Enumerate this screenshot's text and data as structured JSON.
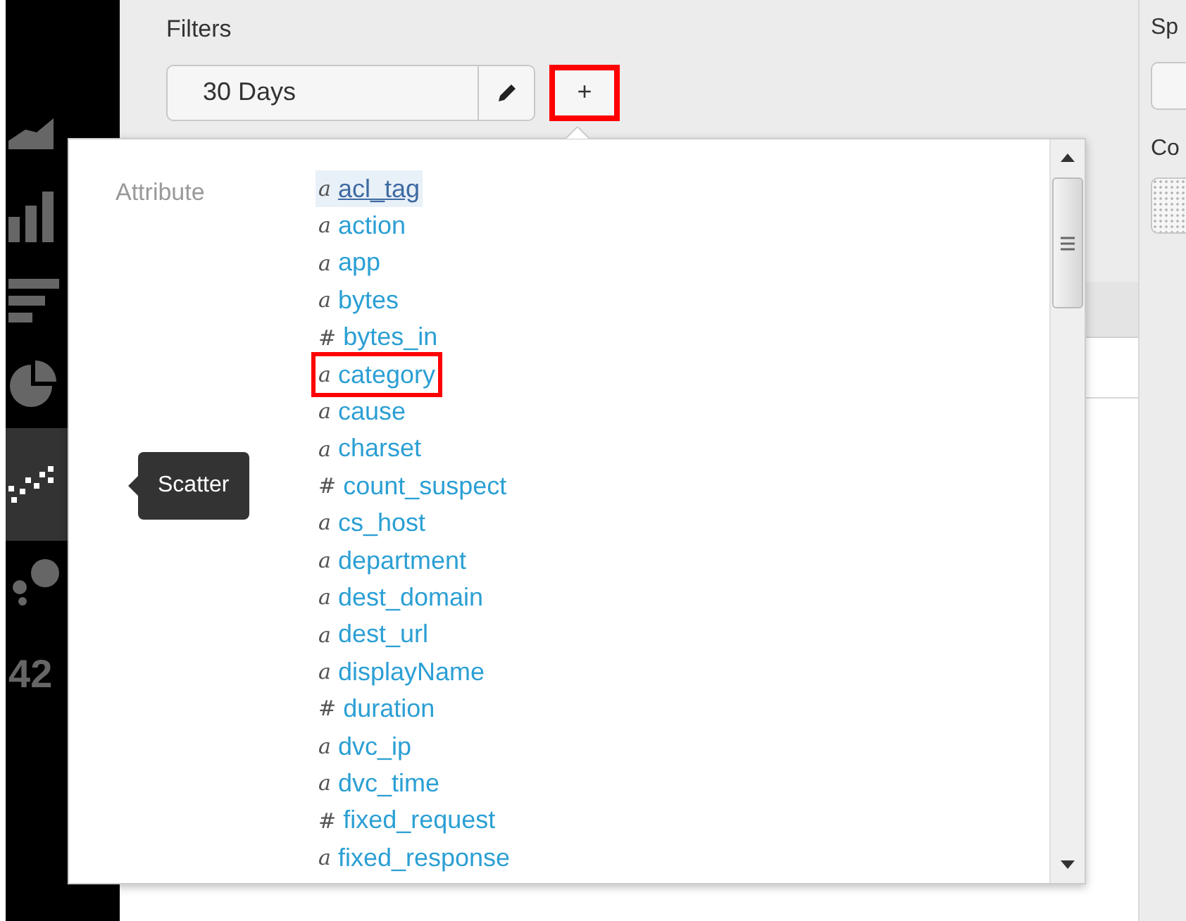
{
  "sidebar": {
    "items": [
      {
        "kind": "area",
        "selected": false
      },
      {
        "kind": "column",
        "selected": false
      },
      {
        "kind": "bar",
        "selected": false
      },
      {
        "kind": "pie",
        "selected": false
      },
      {
        "kind": "scatter",
        "selected": true
      },
      {
        "kind": "bubble",
        "selected": false
      },
      {
        "kind": "single",
        "label": "42",
        "selected": false
      }
    ],
    "tooltip": "Scatter"
  },
  "filters": {
    "label": "Filters",
    "value": "30 Days",
    "add_button": "+",
    "add_highlighted": true
  },
  "right_panel": {
    "label_1": "Sp",
    "label_2": "Co"
  },
  "popup": {
    "heading": "Attribute",
    "items": [
      {
        "glyph": "a",
        "name": "acl_tag",
        "selected": true,
        "highlighted": false
      },
      {
        "glyph": "a",
        "name": "action",
        "selected": false,
        "highlighted": false
      },
      {
        "glyph": "a",
        "name": "app",
        "selected": false,
        "highlighted": false
      },
      {
        "glyph": "a",
        "name": "bytes",
        "selected": false,
        "highlighted": false
      },
      {
        "glyph": "#",
        "name": "bytes_in",
        "selected": false,
        "highlighted": false
      },
      {
        "glyph": "a",
        "name": "category",
        "selected": false,
        "highlighted": true
      },
      {
        "glyph": "a",
        "name": "cause",
        "selected": false,
        "highlighted": false
      },
      {
        "glyph": "a",
        "name": "charset",
        "selected": false,
        "highlighted": false
      },
      {
        "glyph": "#",
        "name": "count_suspect",
        "selected": false,
        "highlighted": false
      },
      {
        "glyph": "a",
        "name": "cs_host",
        "selected": false,
        "highlighted": false
      },
      {
        "glyph": "a",
        "name": "department",
        "selected": false,
        "highlighted": false
      },
      {
        "glyph": "a",
        "name": "dest_domain",
        "selected": false,
        "highlighted": false
      },
      {
        "glyph": "a",
        "name": "dest_url",
        "selected": false,
        "highlighted": false
      },
      {
        "glyph": "a",
        "name": "displayName",
        "selected": false,
        "highlighted": false
      },
      {
        "glyph": "#",
        "name": "duration",
        "selected": false,
        "highlighted": false
      },
      {
        "glyph": "a",
        "name": "dvc_ip",
        "selected": false,
        "highlighted": false
      },
      {
        "glyph": "a",
        "name": "dvc_time",
        "selected": false,
        "highlighted": false
      },
      {
        "glyph": "#",
        "name": "fixed_request",
        "selected": false,
        "highlighted": false
      },
      {
        "glyph": "a",
        "name": "fixed_response",
        "selected": false,
        "highlighted": false
      }
    ]
  }
}
